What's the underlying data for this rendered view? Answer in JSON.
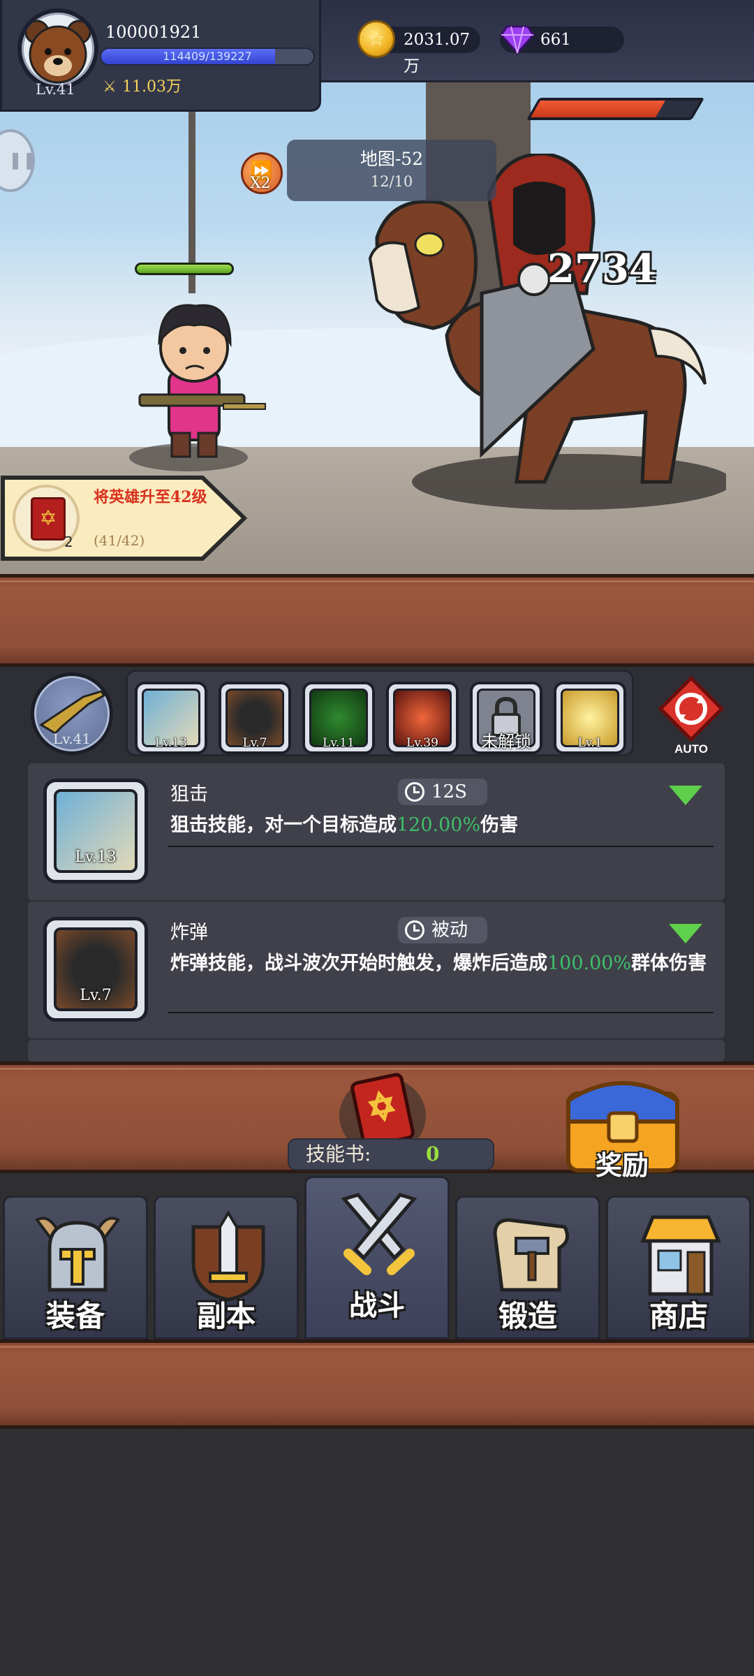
{
  "player": {
    "id": "100001921",
    "level_label": "Lv.41",
    "xp_text": "114409/139227",
    "xp_fraction": 0.82,
    "power": "11.03万"
  },
  "currency": {
    "gold": "2031.07万",
    "gems": "661"
  },
  "battle": {
    "speed_label": "X2",
    "map_title": "地图-52",
    "map_progress": "12/10",
    "damage_number": "2734",
    "enemy_hp_fraction": 0.78,
    "hero_hp_fraction": 1.0
  },
  "quest": {
    "title": "将英雄升至42级",
    "progress": "(41/42)",
    "item_count": "2"
  },
  "skill_bar": {
    "weapon_level": "Lv.41",
    "slots": [
      {
        "level": "Lv.13",
        "icon": "sniper-skill-icon"
      },
      {
        "level": "Lv.7",
        "icon": "bomb-skill-icon"
      },
      {
        "level": "Lv.11",
        "icon": "poison-skill-icon"
      },
      {
        "level": "Lv.39",
        "icon": "fire-skill-icon"
      },
      {
        "level": "未解锁",
        "icon": "lock-icon"
      },
      {
        "level": "Lv.1",
        "icon": "lightning-skill-icon"
      }
    ],
    "auto_label": "AUTO"
  },
  "skills": [
    {
      "name": "狙击",
      "level": "Lv.13",
      "cooldown": "12S",
      "desc_before": "狙击技能，对一个目标造成",
      "desc_highlight": "120.00%",
      "desc_after": "伤害"
    },
    {
      "name": "炸弹",
      "level": "Lv.7",
      "cooldown": "被动",
      "desc_before": "炸弹技能，战斗波次开始时触发，爆炸后造成",
      "desc_highlight": "100.00%",
      "desc_after": "群体伤害"
    }
  ],
  "skill_book": {
    "label": "技能书:",
    "count": "0"
  },
  "reward_label": "奖励",
  "nav": [
    {
      "label": "装备",
      "icon": "helmet-icon"
    },
    {
      "label": "副本",
      "icon": "sword-shield-icon"
    },
    {
      "label": "战斗",
      "icon": "crossed-swords-icon"
    },
    {
      "label": "锻造",
      "icon": "forge-scroll-icon"
    },
    {
      "label": "商店",
      "icon": "shop-icon"
    }
  ],
  "colors": {
    "hud_bg": "#323649",
    "wood": "#8f5038",
    "highlight_green": "#3fbf6a",
    "panel_bg": "#2e2f35",
    "card_bg": "#3f4049"
  }
}
